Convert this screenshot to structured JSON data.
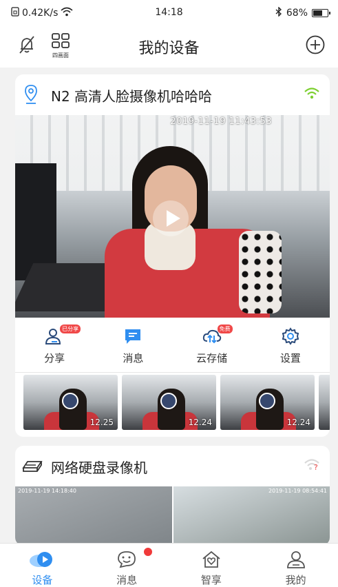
{
  "status": {
    "speed": "0.42K/s",
    "time": "14:18",
    "battery": "68%",
    "battery_level": 0.68
  },
  "header": {
    "title": "我的设备",
    "quad_label": "四画面"
  },
  "device1": {
    "name": "N2 高清人脸摄像机哈哈哈",
    "timestamp": "2019-11-19 11:43:53",
    "actions": [
      {
        "label": "分享",
        "badge": "已分享"
      },
      {
        "label": "消息"
      },
      {
        "label": "云存储",
        "badge": "免费"
      },
      {
        "label": "设置"
      }
    ],
    "thumbs": [
      {
        "date": "12.25"
      },
      {
        "date": "12.24"
      },
      {
        "date": "12.24"
      }
    ]
  },
  "device2": {
    "name": "网络硬盘录像机",
    "cam1_ts": "2019-11-19 14:18:40",
    "cam2_ts": "2019-11-19 08:54:41"
  },
  "tabs": [
    {
      "label": "设备",
      "active": true
    },
    {
      "label": "消息"
    },
    {
      "label": "智享"
    },
    {
      "label": "我的"
    }
  ],
  "colors": {
    "accent": "#2f8ef0",
    "wifi_ok": "#7ccf2f",
    "alert": "#f04848"
  }
}
